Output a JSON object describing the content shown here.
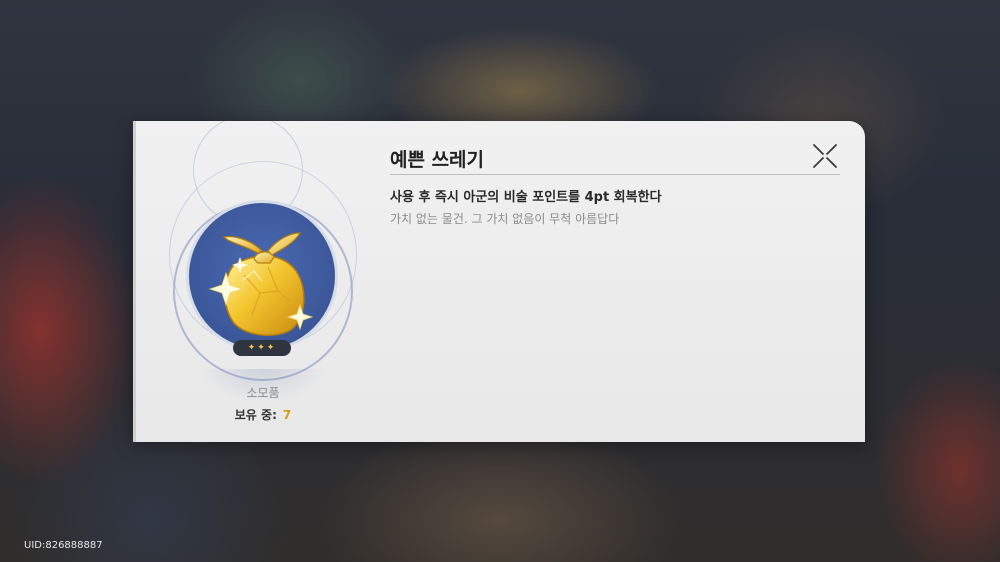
{
  "item": {
    "name": "예쁜 쓰레기",
    "effect": "사용 후 즉시 아군의 비술 포인트를 4pt 회복한다",
    "flavor": "가치 없는 물건. 그 가치 없음이 무척 아름답다",
    "rarity_stars": "✦✦✦",
    "category": "소모품",
    "owned_label": "보유 중:",
    "owned_count": "7",
    "icon": "golden-bag-icon"
  },
  "close_icon": "close-icon",
  "uid": "UID:826888887",
  "colors": {
    "panel_bg": "#efefef",
    "item_circle": "#3f5ca1",
    "owned_count": "#d99b1f",
    "rarity_star": "#f1c84d"
  }
}
